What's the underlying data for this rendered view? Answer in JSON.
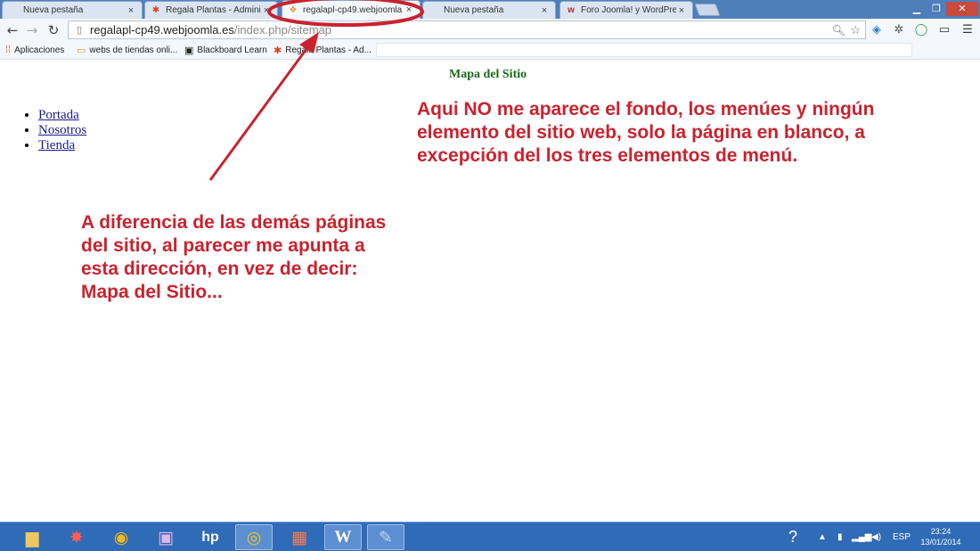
{
  "browser": {
    "tabs": [
      {
        "label": "Nueva pestaña",
        "favicon": "blank",
        "active": false
      },
      {
        "label": "Regala Plantas - Administ",
        "favicon": "joomla-icon",
        "active": false
      },
      {
        "label": "regalapl-cp49.webjoomla",
        "favicon": "page-icon",
        "active": true
      },
      {
        "label": "Nueva pestaña",
        "favicon": "blank",
        "active": false
      },
      {
        "label": "Foro Joomla! y WordPress",
        "favicon": "forum-icon",
        "active": false
      }
    ],
    "close_glyph": "×",
    "address": {
      "host": "regalapl-cp49.webjoomla.es",
      "path": "/index.php/sitemap"
    },
    "bookmarks": [
      {
        "label": "Aplicaciones",
        "icon": "apps-grid-icon"
      },
      {
        "label": "webs de tiendas onli...",
        "icon": "folder-icon"
      },
      {
        "label": "Blackboard Learn",
        "icon": "blackboard-icon"
      },
      {
        "label": "Regala Plantas - Ad...",
        "icon": "joomla-icon"
      }
    ]
  },
  "page": {
    "title": "Mapa del Sitio",
    "menu": [
      "Portada",
      "Nosotros",
      "Tienda"
    ]
  },
  "annotations": {
    "note_right": "Aqui NO me aparece el fondo, los menúes y  ningún elemento del sitio web, solo la página en blanco, a excepción del los tres elementos de menú.",
    "note_left": "A diferencia de las demás páginas del sitio, al parecer me apunta a esta dirección, en vez de decir: Mapa del Sitio...",
    "color": "#c8232f"
  },
  "taskbar": {
    "apps": [
      "file-explorer-icon",
      "games-icon",
      "media-player-icon",
      "presentation-icon",
      "hp-icon",
      "chrome-icon",
      "apps-icon",
      "word-icon",
      "paint-icon"
    ],
    "language": "ESP",
    "time": "23:24",
    "date": "13/01/2014"
  },
  "colors": {
    "tabstrip": "#4e7fbb",
    "taskbar": "#2f6bb7",
    "page_title": "#1a6b1a",
    "link": "#1a1a8c"
  }
}
